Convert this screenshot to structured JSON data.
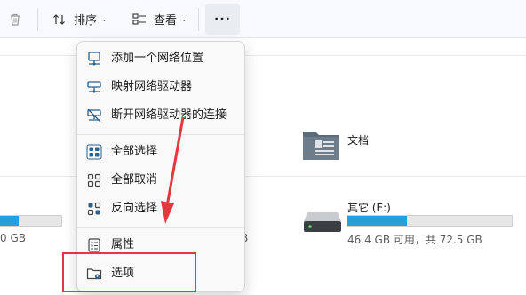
{
  "toolbar": {
    "sort_label": "排序",
    "view_label": "查看",
    "more_label": "···"
  },
  "background": {
    "documents_label": "文档",
    "drive_e_label": "其它 (E:)",
    "drive_e_size": "46.4 GB 可用，共 72.5 GB",
    "drive_e_used_fraction": 0.36,
    "left_drive_size_fragment": "0 GB",
    "left_drive_used_fraction": 0.32,
    "middle_drive_size_fragment": "B"
  },
  "menu": {
    "items": [
      {
        "label": "添加一个网络位置",
        "icon": "add-network-location-icon"
      },
      {
        "label": "映射网络驱动器",
        "icon": "map-network-drive-icon"
      },
      {
        "label": "断开网络驱动器的连接",
        "icon": "disconnect-network-drive-icon"
      },
      {
        "label": "全部选择",
        "icon": "select-all-icon"
      },
      {
        "label": "全部取消",
        "icon": "select-none-icon"
      },
      {
        "label": "反向选择",
        "icon": "invert-selection-icon"
      },
      {
        "label": "属性",
        "icon": "properties-icon"
      },
      {
        "label": "选项",
        "icon": "options-icon"
      }
    ]
  },
  "annotation": {
    "color": "#e0393e"
  }
}
